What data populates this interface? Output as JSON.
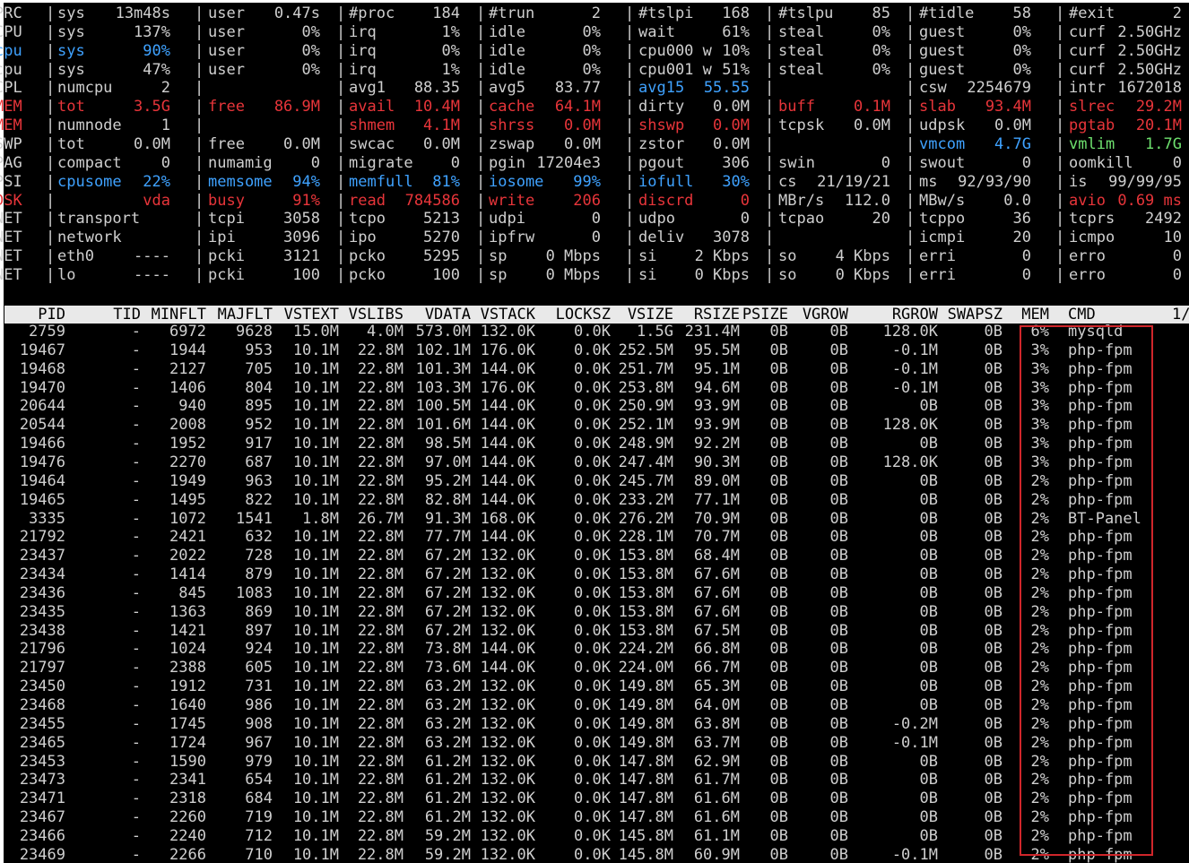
{
  "sys_rows": [
    {
      "tag": "PRC",
      "tag_color": "white",
      "fields": [
        {
          "l": "sys",
          "v": "13m48s"
        },
        {
          "l": "user",
          "v": "0.47s"
        },
        {
          "l": "#proc",
          "v": "184"
        },
        {
          "l": "#trun",
          "v": "2"
        },
        {
          "l": "#tslpi",
          "v": "168"
        },
        {
          "l": "#tslpu",
          "v": "85"
        },
        {
          "l": "#tidle",
          "v": "58"
        },
        {
          "l": "#exit",
          "v": "2"
        }
      ]
    },
    {
      "tag": "CPU",
      "tag_color": "white",
      "fields": [
        {
          "l": "sys",
          "v": "137%"
        },
        {
          "l": "user",
          "v": "0%"
        },
        {
          "l": "irq",
          "v": "1%"
        },
        {
          "l": "idle",
          "v": "0%"
        },
        {
          "l": "wait",
          "v": "61%"
        },
        {
          "l": "steal",
          "v": "0%"
        },
        {
          "l": "guest",
          "v": "0%"
        },
        {
          "l": "curf",
          "v": "2.50GHz"
        }
      ]
    },
    {
      "tag": "cpu",
      "tag_color": "blue",
      "fields": [
        {
          "l": "sys",
          "v": "90%",
          "c": "blue"
        },
        {
          "l": "user",
          "v": "0%"
        },
        {
          "l": "irq",
          "v": "0%"
        },
        {
          "l": "idle",
          "v": "0%"
        },
        {
          "l": "cpu000 w",
          "v": "10%"
        },
        {
          "l": "steal",
          "v": "0%"
        },
        {
          "l": "guest",
          "v": "0%"
        },
        {
          "l": "curf",
          "v": "2.50GHz"
        }
      ]
    },
    {
      "tag": "cpu",
      "tag_color": "white",
      "fields": [
        {
          "l": "sys",
          "v": "47%"
        },
        {
          "l": "user",
          "v": "0%"
        },
        {
          "l": "irq",
          "v": "1%"
        },
        {
          "l": "idle",
          "v": "0%"
        },
        {
          "l": "cpu001 w",
          "v": "51%"
        },
        {
          "l": "steal",
          "v": "0%"
        },
        {
          "l": "guest",
          "v": "0%"
        },
        {
          "l": "curf",
          "v": "2.50GHz"
        }
      ]
    },
    {
      "tag": "CPL",
      "tag_color": "white",
      "fields": [
        {
          "l": "numcpu",
          "v": "2"
        },
        {
          "l": "",
          "v": ""
        },
        {
          "l": "avg1",
          "v": "88.35"
        },
        {
          "l": "avg5",
          "v": "83.77"
        },
        {
          "l": "avg15",
          "v": "55.55",
          "c": "blue"
        },
        {
          "l": "",
          "v": ""
        },
        {
          "l": "csw",
          "v": "2254679"
        },
        {
          "l": "intr",
          "v": "1672018"
        }
      ]
    },
    {
      "tag": "MEM",
      "tag_color": "red",
      "fields": [
        {
          "l": "tot",
          "v": "3.5G",
          "c": "red"
        },
        {
          "l": "free",
          "v": "86.9M",
          "c": "red"
        },
        {
          "l": "avail",
          "v": "10.4M",
          "c": "red"
        },
        {
          "l": "cache",
          "v": "64.1M",
          "c": "red"
        },
        {
          "l": "dirty",
          "v": "0.0M"
        },
        {
          "l": "buff",
          "v": "0.1M",
          "c": "red"
        },
        {
          "l": "slab",
          "v": "93.4M",
          "c": "red"
        },
        {
          "l": "slrec",
          "v": "29.2M",
          "c": "red"
        }
      ]
    },
    {
      "tag": "MEM",
      "tag_color": "red",
      "fields": [
        {
          "l": "numnode",
          "v": "1"
        },
        {
          "l": "",
          "v": ""
        },
        {
          "l": "shmem",
          "v": "4.1M",
          "c": "red"
        },
        {
          "l": "shrss",
          "v": "0.0M",
          "c": "red"
        },
        {
          "l": "shswp",
          "v": "0.0M",
          "c": "red"
        },
        {
          "l": "tcpsk",
          "v": "0.0M"
        },
        {
          "l": "udpsk",
          "v": "0.0M"
        },
        {
          "l": "pgtab",
          "v": "20.1M",
          "c": "red"
        }
      ]
    },
    {
      "tag": "SWP",
      "tag_color": "white",
      "fields": [
        {
          "l": "tot",
          "v": "0.0M"
        },
        {
          "l": "free",
          "v": "0.0M"
        },
        {
          "l": "swcac",
          "v": "0.0M"
        },
        {
          "l": "zswap",
          "v": "0.0M"
        },
        {
          "l": "zstor",
          "v": "0.0M"
        },
        {
          "l": "",
          "v": ""
        },
        {
          "l": "vmcom",
          "v": "4.7G",
          "c": "blue"
        },
        {
          "l": "vmlim",
          "v": "1.7G",
          "c": "green"
        }
      ]
    },
    {
      "tag": "PAG",
      "tag_color": "white",
      "fields": [
        {
          "l": "compact",
          "v": "0"
        },
        {
          "l": "numamig",
          "v": "0"
        },
        {
          "l": "migrate",
          "v": "0"
        },
        {
          "l": "pgin",
          "v": "17204e3"
        },
        {
          "l": "pgout",
          "v": "306"
        },
        {
          "l": "swin",
          "v": "0"
        },
        {
          "l": "swout",
          "v": "0"
        },
        {
          "l": "oomkill",
          "v": "0"
        }
      ]
    },
    {
      "tag": "PSI",
      "tag_color": "white",
      "fields": [
        {
          "l": "cpusome",
          "v": "22%",
          "c": "blue"
        },
        {
          "l": "memsome",
          "v": "94%",
          "c": "blue"
        },
        {
          "l": "memfull",
          "v": "81%",
          "c": "blue"
        },
        {
          "l": "iosome",
          "v": "99%",
          "c": "blue"
        },
        {
          "l": "iofull",
          "v": "30%",
          "c": "blue"
        },
        {
          "l": "cs",
          "v": "21/19/21"
        },
        {
          "l": "ms",
          "v": "92/93/90"
        },
        {
          "l": "is",
          "v": "99/99/95"
        }
      ]
    },
    {
      "tag": "DSK",
      "tag_color": "red",
      "fields": [
        {
          "l": "",
          "v": "vda",
          "c": "red"
        },
        {
          "l": "busy",
          "v": "91%",
          "c": "red"
        },
        {
          "l": "read",
          "v": "784586",
          "c": "red"
        },
        {
          "l": "write",
          "v": "206",
          "c": "red"
        },
        {
          "l": "discrd",
          "v": "0",
          "c": "red"
        },
        {
          "l": "MBr/s",
          "v": "112.0"
        },
        {
          "l": "MBw/s",
          "v": "0.0"
        },
        {
          "l": "avio",
          "v": "0.69 ms",
          "c": "red"
        }
      ]
    },
    {
      "tag": "NET",
      "tag_color": "white",
      "fields": [
        {
          "l": "transport",
          "v": ""
        },
        {
          "l": "tcpi",
          "v": "3058"
        },
        {
          "l": "tcpo",
          "v": "5213"
        },
        {
          "l": "udpi",
          "v": "0"
        },
        {
          "l": "udpo",
          "v": "0"
        },
        {
          "l": "tcpao",
          "v": "20"
        },
        {
          "l": "tcppo",
          "v": "36"
        },
        {
          "l": "tcprs",
          "v": "2492"
        }
      ]
    },
    {
      "tag": "NET",
      "tag_color": "white",
      "fields": [
        {
          "l": "network",
          "v": ""
        },
        {
          "l": "ipi",
          "v": "3096"
        },
        {
          "l": "ipo",
          "v": "5270"
        },
        {
          "l": "ipfrw",
          "v": "0"
        },
        {
          "l": "deliv",
          "v": "3078"
        },
        {
          "l": "",
          "v": ""
        },
        {
          "l": "icmpi",
          "v": "20"
        },
        {
          "l": "icmpo",
          "v": "10"
        }
      ]
    },
    {
      "tag": "NET",
      "tag_color": "white",
      "fields": [
        {
          "l": "eth0",
          "v": "----"
        },
        {
          "l": "pcki",
          "v": "3121"
        },
        {
          "l": "pcko",
          "v": "5295"
        },
        {
          "l": "sp",
          "v": "0 Mbps"
        },
        {
          "l": "si",
          "v": "2 Kbps"
        },
        {
          "l": "so",
          "v": "4 Kbps"
        },
        {
          "l": "erri",
          "v": "0"
        },
        {
          "l": "erro",
          "v": "0"
        }
      ]
    },
    {
      "tag": "NET",
      "tag_color": "white",
      "fields": [
        {
          "l": "lo",
          "v": "----"
        },
        {
          "l": "pcki",
          "v": "100"
        },
        {
          "l": "pcko",
          "v": "100"
        },
        {
          "l": "sp",
          "v": "0 Mbps"
        },
        {
          "l": "si",
          "v": "0 Kbps"
        },
        {
          "l": "so",
          "v": "0 Kbps"
        },
        {
          "l": "erri",
          "v": "0"
        },
        {
          "l": "erro",
          "v": "0"
        }
      ]
    }
  ],
  "process_table": {
    "columns": [
      "PID",
      "TID",
      "MINFLT",
      "MAJFLT",
      "VSTEXT",
      "VSLIBS",
      "VDATA",
      "VSTACK",
      "LOCKSZ",
      "VSIZE",
      "RSIZE",
      "PSIZE",
      "VGROW",
      "RGROW",
      "SWAPSZ",
      "MEM",
      "CMD",
      "1/"
    ],
    "rows": [
      [
        "2759",
        "-",
        "6972",
        "9628",
        "15.0M",
        "4.0M",
        "573.0M",
        "132.0K",
        "0.0K",
        "1.5G",
        "231.4M",
        "0B",
        "0B",
        "128.0K",
        "0B",
        "6%",
        "mysqld"
      ],
      [
        "19467",
        "-",
        "1944",
        "953",
        "10.1M",
        "22.8M",
        "102.1M",
        "176.0K",
        "0.0K",
        "252.5M",
        "95.5M",
        "0B",
        "0B",
        "-0.1M",
        "0B",
        "3%",
        "php-fpm"
      ],
      [
        "19468",
        "-",
        "2127",
        "705",
        "10.1M",
        "22.8M",
        "101.3M",
        "144.0K",
        "0.0K",
        "251.7M",
        "95.1M",
        "0B",
        "0B",
        "-0.1M",
        "0B",
        "3%",
        "php-fpm"
      ],
      [
        "19470",
        "-",
        "1406",
        "804",
        "10.1M",
        "22.8M",
        "103.3M",
        "176.0K",
        "0.0K",
        "253.8M",
        "94.6M",
        "0B",
        "0B",
        "-0.1M",
        "0B",
        "3%",
        "php-fpm"
      ],
      [
        "20644",
        "-",
        "940",
        "895",
        "10.1M",
        "22.8M",
        "100.5M",
        "144.0K",
        "0.0K",
        "250.9M",
        "93.9M",
        "0B",
        "0B",
        "0B",
        "0B",
        "3%",
        "php-fpm"
      ],
      [
        "20544",
        "-",
        "2008",
        "952",
        "10.1M",
        "22.8M",
        "101.6M",
        "144.0K",
        "0.0K",
        "252.1M",
        "93.9M",
        "0B",
        "0B",
        "128.0K",
        "0B",
        "3%",
        "php-fpm"
      ],
      [
        "19466",
        "-",
        "1952",
        "917",
        "10.1M",
        "22.8M",
        "98.5M",
        "144.0K",
        "0.0K",
        "248.9M",
        "92.2M",
        "0B",
        "0B",
        "0B",
        "0B",
        "3%",
        "php-fpm"
      ],
      [
        "19476",
        "-",
        "2270",
        "687",
        "10.1M",
        "22.8M",
        "97.0M",
        "144.0K",
        "0.0K",
        "247.4M",
        "90.3M",
        "0B",
        "0B",
        "128.0K",
        "0B",
        "3%",
        "php-fpm"
      ],
      [
        "19464",
        "-",
        "1949",
        "963",
        "10.1M",
        "22.8M",
        "95.2M",
        "144.0K",
        "0.0K",
        "245.7M",
        "89.0M",
        "0B",
        "0B",
        "0B",
        "0B",
        "2%",
        "php-fpm"
      ],
      [
        "19465",
        "-",
        "1495",
        "822",
        "10.1M",
        "22.8M",
        "82.8M",
        "144.0K",
        "0.0K",
        "233.2M",
        "77.1M",
        "0B",
        "0B",
        "0B",
        "0B",
        "2%",
        "php-fpm"
      ],
      [
        "3335",
        "-",
        "1072",
        "1541",
        "1.8M",
        "26.7M",
        "91.3M",
        "168.0K",
        "0.0K",
        "276.2M",
        "70.9M",
        "0B",
        "0B",
        "0B",
        "0B",
        "2%",
        "BT-Panel"
      ],
      [
        "21792",
        "-",
        "2421",
        "632",
        "10.1M",
        "22.8M",
        "77.7M",
        "144.0K",
        "0.0K",
        "228.1M",
        "70.7M",
        "0B",
        "0B",
        "0B",
        "0B",
        "2%",
        "php-fpm"
      ],
      [
        "23437",
        "-",
        "2022",
        "728",
        "10.1M",
        "22.8M",
        "67.2M",
        "132.0K",
        "0.0K",
        "153.8M",
        "68.4M",
        "0B",
        "0B",
        "0B",
        "0B",
        "2%",
        "php-fpm"
      ],
      [
        "23434",
        "-",
        "1414",
        "879",
        "10.1M",
        "22.8M",
        "67.2M",
        "132.0K",
        "0.0K",
        "153.8M",
        "67.6M",
        "0B",
        "0B",
        "0B",
        "0B",
        "2%",
        "php-fpm"
      ],
      [
        "23436",
        "-",
        "845",
        "1083",
        "10.1M",
        "22.8M",
        "67.2M",
        "132.0K",
        "0.0K",
        "153.8M",
        "67.6M",
        "0B",
        "0B",
        "0B",
        "0B",
        "2%",
        "php-fpm"
      ],
      [
        "23435",
        "-",
        "1363",
        "869",
        "10.1M",
        "22.8M",
        "67.2M",
        "132.0K",
        "0.0K",
        "153.8M",
        "67.6M",
        "0B",
        "0B",
        "0B",
        "0B",
        "2%",
        "php-fpm"
      ],
      [
        "23438",
        "-",
        "1421",
        "897",
        "10.1M",
        "22.8M",
        "67.2M",
        "132.0K",
        "0.0K",
        "153.8M",
        "67.5M",
        "0B",
        "0B",
        "0B",
        "0B",
        "2%",
        "php-fpm"
      ],
      [
        "21796",
        "-",
        "1024",
        "924",
        "10.1M",
        "22.8M",
        "73.8M",
        "144.0K",
        "0.0K",
        "224.2M",
        "66.8M",
        "0B",
        "0B",
        "0B",
        "0B",
        "2%",
        "php-fpm"
      ],
      [
        "21797",
        "-",
        "2388",
        "605",
        "10.1M",
        "22.8M",
        "73.6M",
        "144.0K",
        "0.0K",
        "224.0M",
        "66.7M",
        "0B",
        "0B",
        "0B",
        "0B",
        "2%",
        "php-fpm"
      ],
      [
        "23450",
        "-",
        "1912",
        "731",
        "10.1M",
        "22.8M",
        "63.2M",
        "132.0K",
        "0.0K",
        "149.8M",
        "65.3M",
        "0B",
        "0B",
        "0B",
        "0B",
        "2%",
        "php-fpm"
      ],
      [
        "23468",
        "-",
        "1640",
        "986",
        "10.1M",
        "22.8M",
        "63.2M",
        "132.0K",
        "0.0K",
        "149.8M",
        "64.0M",
        "0B",
        "0B",
        "0B",
        "0B",
        "2%",
        "php-fpm"
      ],
      [
        "23455",
        "-",
        "1745",
        "908",
        "10.1M",
        "22.8M",
        "63.2M",
        "132.0K",
        "0.0K",
        "149.8M",
        "63.8M",
        "0B",
        "0B",
        "-0.2M",
        "0B",
        "2%",
        "php-fpm"
      ],
      [
        "23465",
        "-",
        "1724",
        "967",
        "10.1M",
        "22.8M",
        "63.2M",
        "132.0K",
        "0.0K",
        "149.8M",
        "63.7M",
        "0B",
        "0B",
        "-0.1M",
        "0B",
        "2%",
        "php-fpm"
      ],
      [
        "23453",
        "-",
        "1590",
        "979",
        "10.1M",
        "22.8M",
        "61.2M",
        "132.0K",
        "0.0K",
        "147.8M",
        "62.9M",
        "0B",
        "0B",
        "0B",
        "0B",
        "2%",
        "php-fpm"
      ],
      [
        "23473",
        "-",
        "2341",
        "654",
        "10.1M",
        "22.8M",
        "61.2M",
        "132.0K",
        "0.0K",
        "147.8M",
        "61.7M",
        "0B",
        "0B",
        "0B",
        "0B",
        "2%",
        "php-fpm"
      ],
      [
        "23471",
        "-",
        "2318",
        "684",
        "10.1M",
        "22.8M",
        "61.2M",
        "132.0K",
        "0.0K",
        "147.8M",
        "61.6M",
        "0B",
        "0B",
        "0B",
        "0B",
        "2%",
        "php-fpm"
      ],
      [
        "23467",
        "-",
        "2260",
        "719",
        "10.1M",
        "22.8M",
        "61.2M",
        "132.0K",
        "0.0K",
        "147.8M",
        "61.6M",
        "0B",
        "0B",
        "0B",
        "0B",
        "2%",
        "php-fpm"
      ],
      [
        "23466",
        "-",
        "2240",
        "712",
        "10.1M",
        "22.8M",
        "59.2M",
        "132.0K",
        "0.0K",
        "145.8M",
        "61.1M",
        "0B",
        "0B",
        "0B",
        "0B",
        "2%",
        "php-fpm"
      ],
      [
        "23469",
        "-",
        "2266",
        "710",
        "10.1M",
        "22.8M",
        "59.2M",
        "132.0K",
        "0.0K",
        "145.8M",
        "60.9M",
        "0B",
        "0B",
        "-0.1M",
        "0B",
        "2%",
        "php-fpm"
      ]
    ]
  },
  "colors": {
    "red": "#e8353a",
    "blue": "#3fa2ff",
    "green": "#6ee06e",
    "text": "#cfcfcf",
    "header_bg": "#e9e9e9",
    "highlight_border": "#d0262b"
  }
}
